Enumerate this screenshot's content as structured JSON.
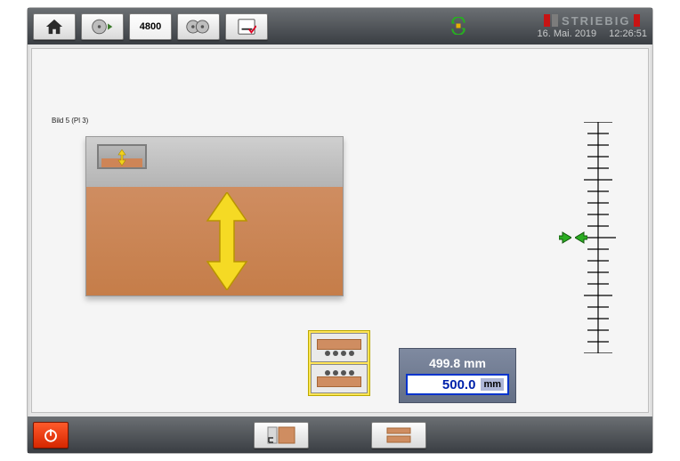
{
  "brand": {
    "name": "STRIEBIG",
    "accent1": "#c81414",
    "accent2": "#7c7c7c"
  },
  "header": {
    "date": "16. Mai. 2019",
    "time": "12:26:51",
    "counter": "4800"
  },
  "picture_label": "Bild 5 (Pl 3)",
  "measurement": {
    "actual": "499.8 mm",
    "target": "500.0",
    "unit": "mm"
  },
  "icons": {
    "home": "home-icon",
    "bladeL": "blade-left-icon",
    "bladeR": "blade-right-icon",
    "dual": "dual-blade-icon",
    "list": "list-check-icon",
    "status": "sync-ok-icon",
    "power": "power-icon",
    "layoutA": "layout-corner-icon",
    "layoutB": "layout-stack-icon"
  }
}
